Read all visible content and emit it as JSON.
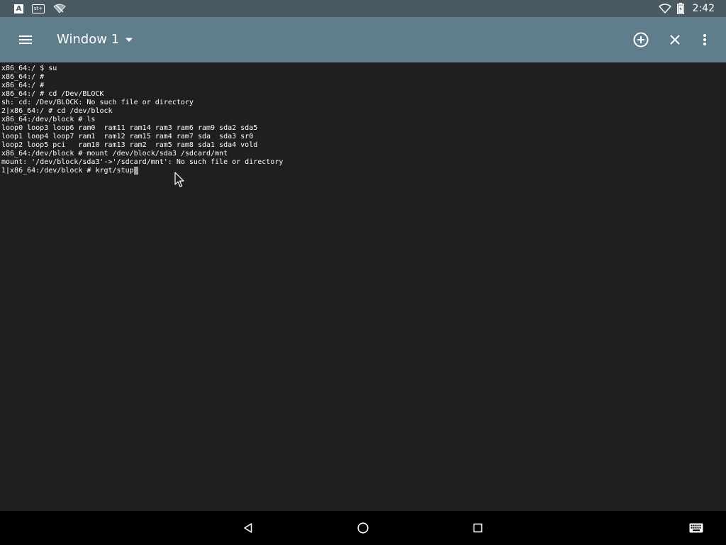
{
  "status_bar": {
    "left_icons": [
      "a-box-icon",
      "sd-card-icon",
      "wifi-off-icon"
    ],
    "time": "2:42",
    "a_label": "A",
    "kb_label": "st+"
  },
  "toolbar": {
    "window_title": "Window 1",
    "actions": [
      "add-window",
      "close-window",
      "more-options"
    ]
  },
  "terminal": {
    "lines": [
      "x86_64:/ $ su",
      "x86_64:/ #",
      "x86_64:/ #",
      "x86_64:/ # cd /Dev/BLOCK",
      "sh: cd: /Dev/BLOCK: No such file or directory",
      "2|x86_64:/ # cd /dev/block",
      "x86_64:/dev/block # ls",
      "loop0 loop3 loop6 ram0  ram11 ram14 ram3 ram6 ram9 sda2 sda5",
      "loop1 loop4 loop7 ram1  ram12 ram15 ram4 ram7 sda  sda3 sr0",
      "loop2 loop5 pci   ram10 ram13 ram2  ram5 ram8 sda1 sda4 vold",
      "x86_64:/dev/block # mount /dev/block/sda3 /sdcard/mnt",
      "mount: '/dev/block/sda3'->'/sdcard/mnt': No such file or directory"
    ],
    "current_input": "1|x86_64:/dev/block # krgt/stup"
  },
  "nav_bar": {
    "buttons": [
      "back",
      "home",
      "recent-apps",
      "keyboard"
    ]
  },
  "colors": {
    "status_bar": "#4a5a63",
    "toolbar": "#607d8b",
    "terminal_bg": "#1f1f1f",
    "terminal_text": "#ffffff",
    "cursor": "#9e9e9e",
    "nav_bar": "#000000"
  }
}
